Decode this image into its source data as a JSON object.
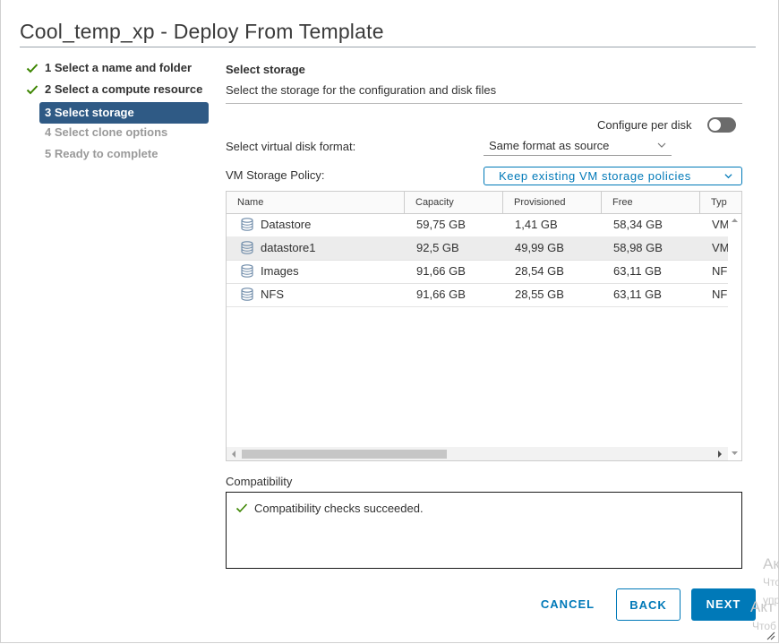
{
  "window": {
    "title": "Cool_temp_xp - Deploy From Template"
  },
  "steps": [
    {
      "label": "1 Select a name and folder",
      "state": "done"
    },
    {
      "label": "2 Select a compute resource",
      "state": "done"
    },
    {
      "label": "3 Select storage",
      "state": "active"
    },
    {
      "label": "4 Select clone options",
      "state": "todo"
    },
    {
      "label": "5 Ready to complete",
      "state": "todo"
    }
  ],
  "section": {
    "title": "Select storage",
    "subtitle": "Select the storage for the configuration and disk files"
  },
  "configure_per_disk": {
    "label": "Configure per disk",
    "enabled": false
  },
  "disk_format": {
    "label": "Select virtual disk format:",
    "value": "Same format as source"
  },
  "storage_policy": {
    "label": "VM Storage Policy:",
    "value": "Keep existing VM storage policies"
  },
  "grid": {
    "columns": [
      "Name",
      "Capacity",
      "Provisioned",
      "Free",
      "Typ"
    ],
    "rows": [
      {
        "name": "Datastore",
        "capacity": "59,75 GB",
        "provisioned": "1,41 GB",
        "free": "58,34 GB",
        "type": "VM",
        "selected": false
      },
      {
        "name": "datastore1",
        "capacity": "92,5 GB",
        "provisioned": "49,99 GB",
        "free": "58,98 GB",
        "type": "VM",
        "selected": true
      },
      {
        "name": "Images",
        "capacity": "91,66 GB",
        "provisioned": "28,54 GB",
        "free": "63,11 GB",
        "type": "NF",
        "selected": false
      },
      {
        "name": "NFS",
        "capacity": "91,66 GB",
        "provisioned": "28,55 GB",
        "free": "63,11 GB",
        "type": "NF",
        "selected": false
      }
    ]
  },
  "compatibility": {
    "label": "Compatibility",
    "message": "Compatibility checks succeeded."
  },
  "buttons": {
    "cancel": "CANCEL",
    "back": "BACK",
    "next": "NEXT"
  },
  "watermark": [
    "Ак",
    "Что",
    "упр",
    "Акт",
    "Чтоб"
  ],
  "colors": {
    "accent": "#0079b8",
    "active_step": "#2f5a85",
    "success": "#3c8500"
  }
}
